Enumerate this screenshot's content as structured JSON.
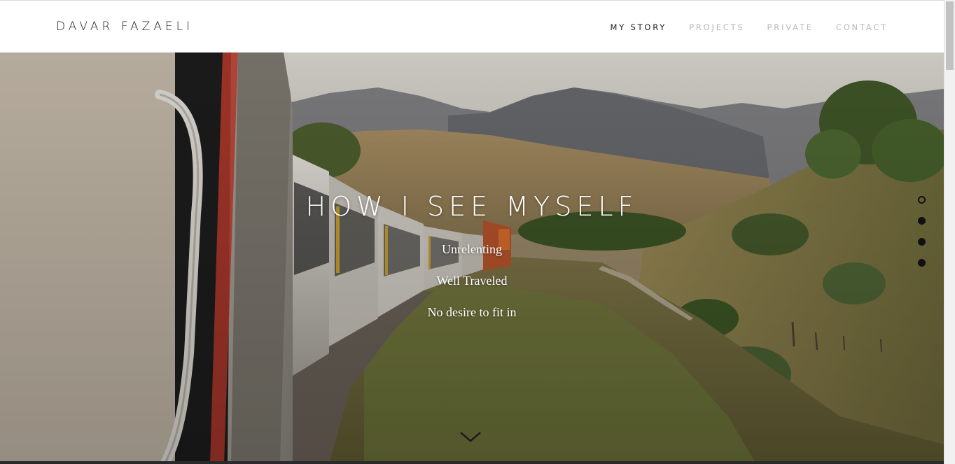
{
  "header": {
    "brand": "DAVAR FAZAELI",
    "nav": [
      {
        "label": "MY STORY",
        "active": true
      },
      {
        "label": "PROJECTS",
        "active": false
      },
      {
        "label": "PRIVATE",
        "active": false
      },
      {
        "label": "CONTACT",
        "active": false
      }
    ]
  },
  "hero": {
    "title": "HOW I SEE MYSELF",
    "lines": [
      "Unrelenting",
      "Well Traveled",
      "No desire to fit in"
    ],
    "scroll_icon": "chevron-down-icon",
    "section_dots": {
      "count": 4,
      "active_index": 0
    }
  }
}
